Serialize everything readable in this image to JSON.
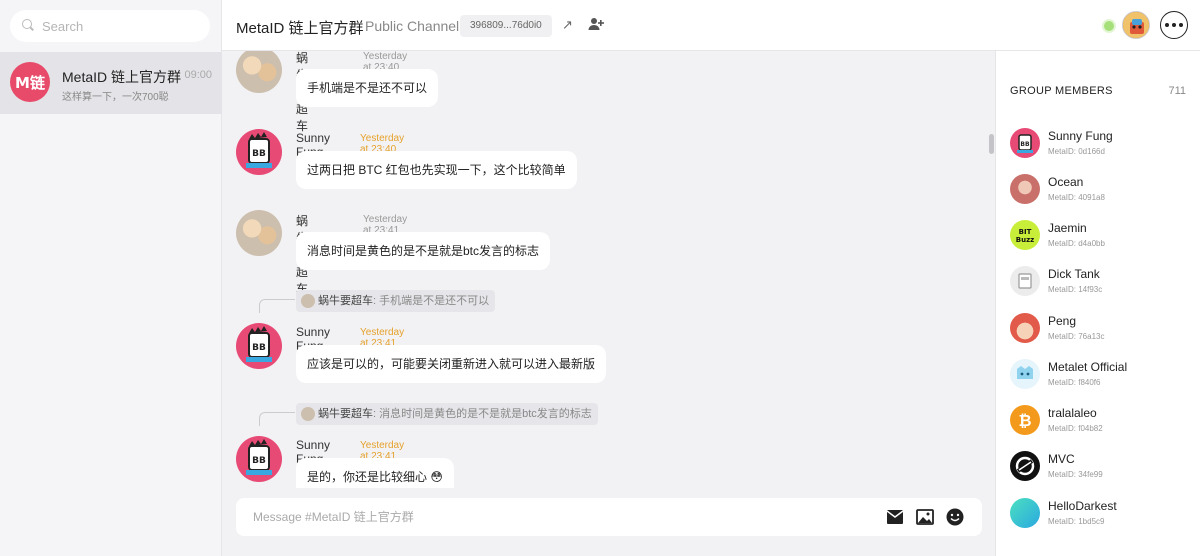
{
  "sidebar": {
    "search_placeholder": "Search",
    "channels": [
      {
        "avatar_text": "M链",
        "name": "MetaID 链上官方群",
        "time": "09:00",
        "preview": "这样算一下，一次700聪"
      }
    ]
  },
  "header": {
    "title": "MetaID 链上官方群",
    "subtitle": "Public Channel",
    "channel_id": "396809...76d0i0",
    "share_icon": "↗"
  },
  "messages": [
    {
      "author": "蜗牛要超车",
      "time": "Yesterday at 23:40",
      "text": "手机端是不是还不可以",
      "avatar": "cat-avatar"
    },
    {
      "author": "Sunny Fung",
      "time": "Yesterday at 23:40",
      "text": "过两日把 BTC 红包也先实现一下，这个比较简单",
      "avatar": "bb-avatar"
    },
    {
      "author": "蜗牛要超车",
      "time": "Yesterday at 23:41",
      "text": "消息时间是黄色的是不是就是btc发言的标志",
      "avatar": "cat-avatar"
    },
    {
      "author": "Sunny Fung",
      "time": "Yesterday at 23:41",
      "text": "应该是可以的，可能要关闭重新进入就可以进入最新版",
      "avatar": "bb-avatar",
      "quote": {
        "name": "蜗牛要超车",
        "text": ": 手机端是不是还不可以"
      }
    },
    {
      "author": "Sunny Fung",
      "time": "Yesterday at 23:41",
      "text": "是的，你还是比较细心 😳",
      "avatar": "bb-avatar",
      "quote": {
        "name": "蜗牛要超车",
        "text": ": 消息时间是黄色的是不是就是btc发言的标志"
      }
    }
  ],
  "composer": {
    "placeholder": "Message #MetaID 链上官方群"
  },
  "members": {
    "title": "GROUP MEMBERS",
    "count": "711",
    "list": [
      {
        "name": "Sunny Fung",
        "id": "MetaID: 0d166d",
        "color": "#e84a76"
      },
      {
        "name": "Ocean",
        "id": "MetaID: 4091a8",
        "color": "#d98a8a"
      },
      {
        "name": "Jaemin",
        "id": "MetaID: d4a0bb",
        "color": "#c9ee3a"
      },
      {
        "name": "Dick Tank",
        "id": "MetaID: 14f93c",
        "color": "#e9e9e9"
      },
      {
        "name": "Peng",
        "id": "MetaID: 76a13c",
        "color": "#e25a4a"
      },
      {
        "name": "Metalet Official",
        "id": "MetaID: f840f6",
        "color": "#bfe6f5"
      },
      {
        "name": "tralalaleo",
        "id": "MetaID: f04b82",
        "color": "#f39a1d"
      },
      {
        "name": "MVC",
        "id": "MetaID: 34fe99",
        "color": "#111111"
      },
      {
        "name": "HelloDarkest",
        "id": "MetaID: 1bd5c9",
        "color": "#3fd0c9"
      }
    ]
  }
}
